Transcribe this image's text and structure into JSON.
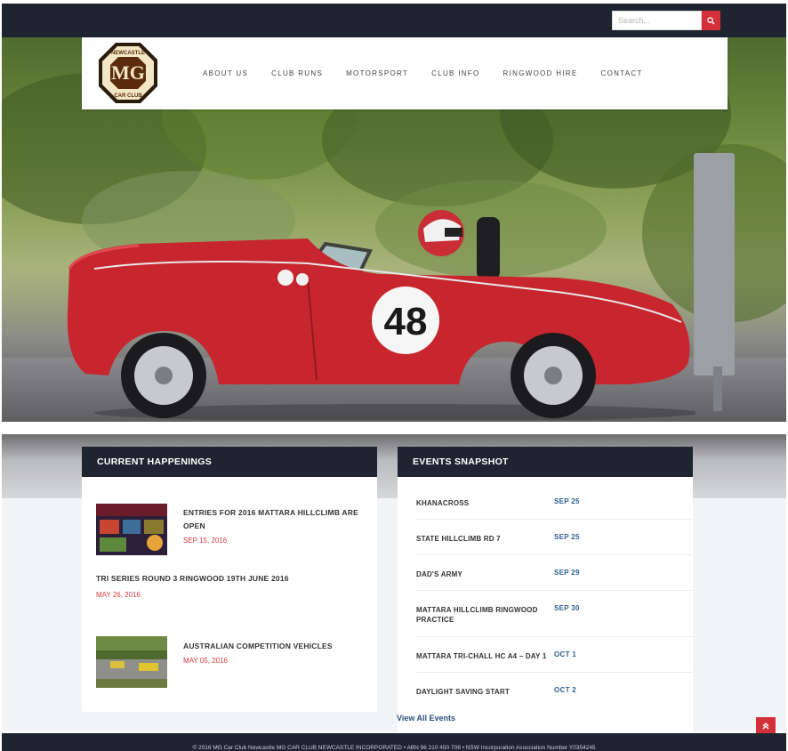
{
  "search": {
    "placeholder": "Search..."
  },
  "logo": {
    "top_text": "NEWCASTLE",
    "mid_text": "MG",
    "bottom_text": "CAR CLUB"
  },
  "nav": [
    {
      "label": "ABOUT US"
    },
    {
      "label": "CLUB RUNS"
    },
    {
      "label": "MOTORSPORT"
    },
    {
      "label": "CLUB INFO"
    },
    {
      "label": "RINGWOOD HIRE"
    },
    {
      "label": "CONTACT"
    }
  ],
  "hero": {
    "car_number": "48"
  },
  "current": {
    "heading": "CURRENT HAPPENINGS",
    "items": [
      {
        "title": "ENTRIES FOR 2016 MATTARA HILLCLIMB ARE OPEN",
        "date": "SEP 15, 2016"
      },
      {
        "title": "TRI SERIES ROUND 3 RINGWOOD 19TH JUNE 2016",
        "date": "MAY 26, 2016"
      },
      {
        "title": "AUSTRALIAN COMPETITION VEHICLES",
        "date": "MAY 05, 2016"
      }
    ]
  },
  "events": {
    "heading": "EVENTS SNAPSHOT",
    "items": [
      {
        "name": "KHANACROSS",
        "date": "SEP 25"
      },
      {
        "name": "STATE HILLCLIMB RD 7",
        "date": "SEP 25"
      },
      {
        "name": "DAD'S ARMY",
        "date": "SEP 29"
      },
      {
        "name": "MATTARA HILLCLIMB RINGWOOD PRACTICE",
        "date": "SEP 30"
      },
      {
        "name": "MATTARA TRI-CHALL HC A4 – DAY 1",
        "date": "OCT 1"
      },
      {
        "name": "DAYLIGHT SAVING START",
        "date": "OCT 2"
      }
    ],
    "view_all": "View All Events"
  },
  "footer": {
    "text": "© 2016 MG Car Club Newcastle MG CAR CLUB NEWCASTLE INCORPORATED  •  ABN 96 210 450 708  •  NSW Incorporation Association Number Y0354245"
  },
  "colors": {
    "dark": "#1f2530",
    "accent_red": "#d42f3a",
    "event_blue": "#2a5e8f",
    "date_red": "#d43a3f"
  },
  "icons": {
    "search": "search-icon",
    "to_top": "chevron-up-icon"
  }
}
